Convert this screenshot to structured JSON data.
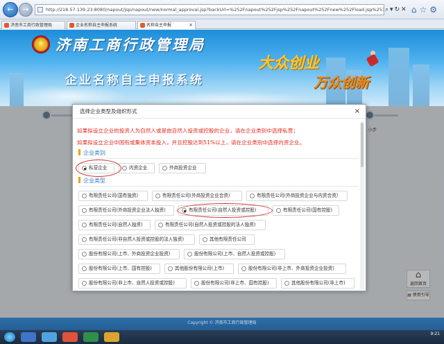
{
  "browser": {
    "url": "http://218.57.139.23:8080/napout/jsp/napout/new/normal_approval.jsp?backUrl=%252Fnapout%252Fjsp%252Fnapout%252Fnew%252Fload.jsp%253Fnat%253Dbak&ex",
    "tabs": [
      {
        "label": "济南市工商行政管理局",
        "active": false
      },
      {
        "label": "企业名称自主申报系统",
        "active": false
      },
      {
        "label": "名称自主申报",
        "active": true
      }
    ]
  },
  "header": {
    "bureau_name": "济南工商行政管理局",
    "system_name": "企业名称自主申报系统",
    "slogan_line1": "大众创业",
    "slogan_line2": "万众创新"
  },
  "page": {
    "step_label_partial": "小步",
    "side_buttons": [
      {
        "icon": "home-icon",
        "label": "返回首页"
      },
      {
        "icon": "manual-icon",
        "label": "使用引导"
      }
    ],
    "footer_text": "Copyright © 济南市工商行政管理局",
    "taskbar_time": "9:21"
  },
  "modal": {
    "title": "选择企业类型及组织形式",
    "close_symbol": "×",
    "notice_line1": "如果拟设立企业的投资人为自然人或是由自然人投资或控股的企业，请在企业类别中选择私营；",
    "notice_line2": "如果拟设立企业中国有或集体资本投入，并且控股达到51%以上，请在企业类别中选择内资企业。",
    "category_heading": "企业类别",
    "categories": [
      {
        "label": "私营企业",
        "selected": true
      },
      {
        "label": "内资企业",
        "selected": false
      },
      {
        "label": "外商投资企业",
        "selected": false
      }
    ],
    "type_heading": "企业类型",
    "types": [
      {
        "label": "有限责任公司(国有独资)",
        "selected": false
      },
      {
        "label": "有限责任公司(外商投资企业合资)",
        "selected": false
      },
      {
        "label": "有限责任公司(外商投资企业与内资合资)",
        "selected": false
      },
      {
        "label": "有限责任公司(外商投资企业法人独资)",
        "selected": false
      },
      {
        "label": "有限责任公司(自然人投资或控股)",
        "selected": true
      },
      {
        "label": "有限责任公司(国有控股)",
        "selected": false
      },
      {
        "label": "有限责任公司(自然人独资)",
        "selected": false
      },
      {
        "label": "有限责任公司(自然人投资或控股的法人独资)",
        "selected": false
      },
      {
        "label": "有限责任公司(非自然人投资或控股的法人独资)",
        "selected": false
      },
      {
        "label": "其他有限责任公司",
        "selected": false
      },
      {
        "label": "股份有限公司(上市、外商投资企业投资)",
        "selected": false
      },
      {
        "label": "股份有限公司(上市、自然人投资或控股)",
        "selected": false
      },
      {
        "label": "股份有限公司(上市、国有控股)",
        "selected": false
      },
      {
        "label": "其他股份有限公司(上市)",
        "selected": false
      },
      {
        "label": "股份有限公司(非上市、外商投资企业投资)",
        "selected": false
      },
      {
        "label": "股份有限公司(非上市、自然人投资或控股)",
        "selected": false
      },
      {
        "label": "股份有限公司(非上市、国有控股)",
        "selected": false
      },
      {
        "label": "其他股份有限公司(非上市)",
        "selected": false
      }
    ]
  },
  "colors": {
    "notice_red": "#e22b1e",
    "section_blue": "#2f7ec2",
    "annotation_circle": "#d0322a",
    "footer_blue": "#2a67a0"
  }
}
